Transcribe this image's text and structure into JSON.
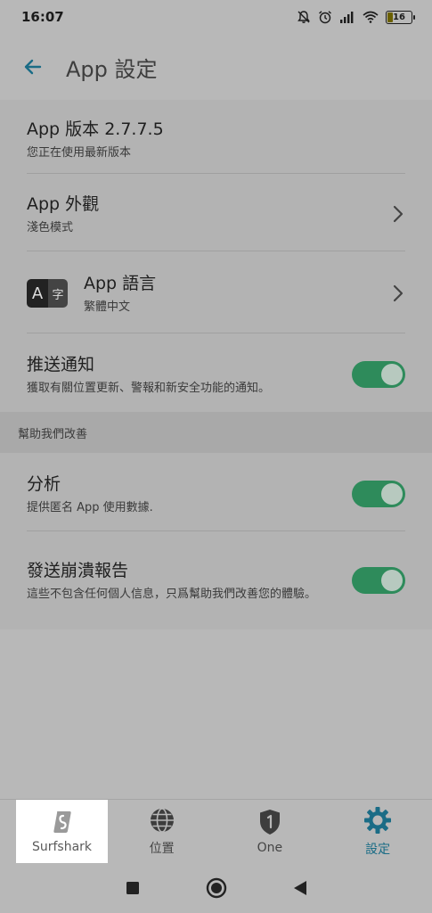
{
  "status_bar": {
    "time": "16:07",
    "battery": "16",
    "icons": [
      "mute-bell-icon",
      "alarm-icon",
      "signal-icon",
      "wifi-icon",
      "battery-icon"
    ]
  },
  "header": {
    "title": "App 設定",
    "back_icon": "back-arrow-icon"
  },
  "settings": {
    "version": {
      "title": "App 版本 2.7.7.5",
      "subtitle": "您正在使用最新版本"
    },
    "appearance": {
      "title": "App 外觀",
      "subtitle": "淺色模式"
    },
    "language": {
      "title": "App 語言",
      "subtitle": "繁體中文",
      "icon_a": "A",
      "icon_zh": "字"
    },
    "push": {
      "title": "推送通知",
      "subtitle": "獲取有關位置更新、警報和新安全功能的通知。",
      "enabled": true
    }
  },
  "help_section": {
    "header": "幫助我們改善",
    "analytics": {
      "title": "分析",
      "subtitle": "提供匿名 App 使用數據.",
      "enabled": true
    },
    "crash": {
      "title": "發送崩潰報告",
      "subtitle": "這些不包含任何個人信息，只爲幫助我們改善您的體驗。",
      "enabled": true
    }
  },
  "bottom_nav": {
    "items": [
      {
        "label": "Surfshark",
        "icon": "surfshark-logo-icon"
      },
      {
        "label": "位置",
        "icon": "globe-icon"
      },
      {
        "label": "One",
        "icon": "shield-one-icon"
      },
      {
        "label": "設定",
        "icon": "gear-icon",
        "active": true
      }
    ]
  },
  "system_nav": [
    "recents-square-icon",
    "home-circle-icon",
    "back-triangle-icon"
  ],
  "colors": {
    "toggle_on": "#2e8b5b",
    "accent": "#1a6c86",
    "background": "#b3b3b3"
  }
}
